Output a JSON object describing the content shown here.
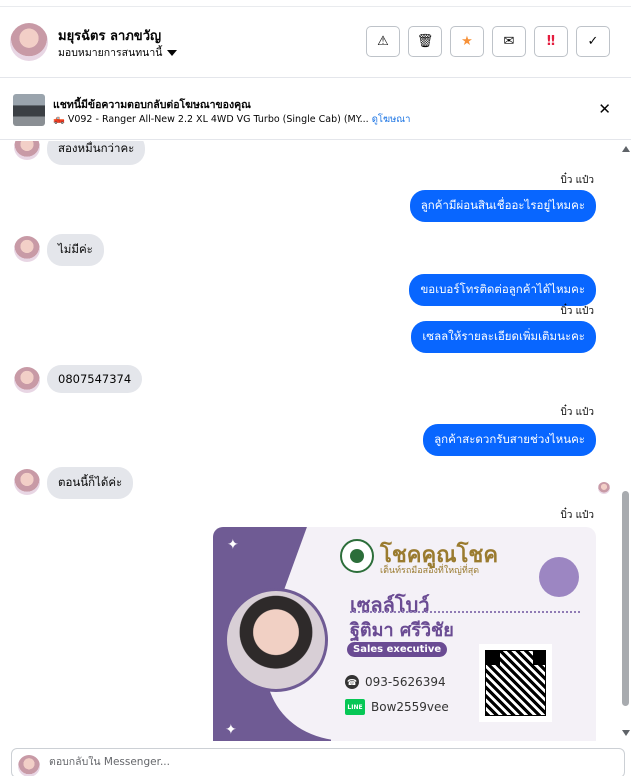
{
  "header": {
    "contact_name": "มยุรฉัตร ลาภขวัญ",
    "assign_label": "มอบหมายการสนทนานี้",
    "actions": [
      {
        "icon": "warning-icon",
        "glyph": "⚠",
        "color": "#050505"
      },
      {
        "icon": "trash-icon",
        "glyph": "🗑",
        "color": "#050505"
      },
      {
        "icon": "star-icon",
        "glyph": "★",
        "color": "#f7923a"
      },
      {
        "icon": "mail-icon",
        "glyph": "✉",
        "color": "#050505"
      },
      {
        "icon": "important-icon",
        "glyph": "‼",
        "color": "#e41e3f"
      },
      {
        "icon": "check-icon",
        "glyph": "✓",
        "color": "#050505"
      }
    ]
  },
  "ad_banner": {
    "title": "แชทนี้มีข้อความตอบกลับต่อโฆษณาของคุณ",
    "vehicle": "🛻 V092 - Ranger All-New 2.2 XL 4WD VG Turbo (Single Cab) (MY...",
    "link": "ดูโฆษณา"
  },
  "messages": {
    "m1": "สองหมื่นกว่าคะ",
    "m2_sender": "บิ๋ว แป๋ว",
    "m2": "ลูกค้ามีผ่อนสินเชื่ออะไรอยู่ไหมคะ",
    "m3": "ไม่มีค่ะ",
    "m4": "ขอเบอร์โทรติดต่อลูกค้าได้ไหมคะ",
    "m5_sender": "บิ๋ว แป๋ว",
    "m5": "เซลลให้รายละเอียดเพิ่มเติมนะคะ",
    "m6": "0807547374",
    "m7_sender": "บิ๋ว แป๋ว",
    "m7": "ลูกค้าสะดวกรับสายช่วงไหนคะ",
    "m8": "ตอนนี้ก็ได้ค่ะ",
    "m9_sender": "บิ๋ว แป๋ว"
  },
  "card": {
    "brand": "โชคคูณโชค",
    "brand_sub": "เต็นท์รถมือสองที่ใหญ่ที่สุด",
    "nickname": "เซลล์โบว์",
    "fullname": "ฐิติมา  ศรีวิชัย",
    "role": "Sales executive",
    "phone": "093-5626394",
    "line_label": "LINE",
    "line_id": "Bow2559vee"
  },
  "composer": {
    "placeholder": "ตอบกลับใน Messenger..."
  },
  "colors": {
    "accent": "#0866ff",
    "incoming_bubble": "#e4e6eb",
    "card_purple": "#6f5b94"
  }
}
